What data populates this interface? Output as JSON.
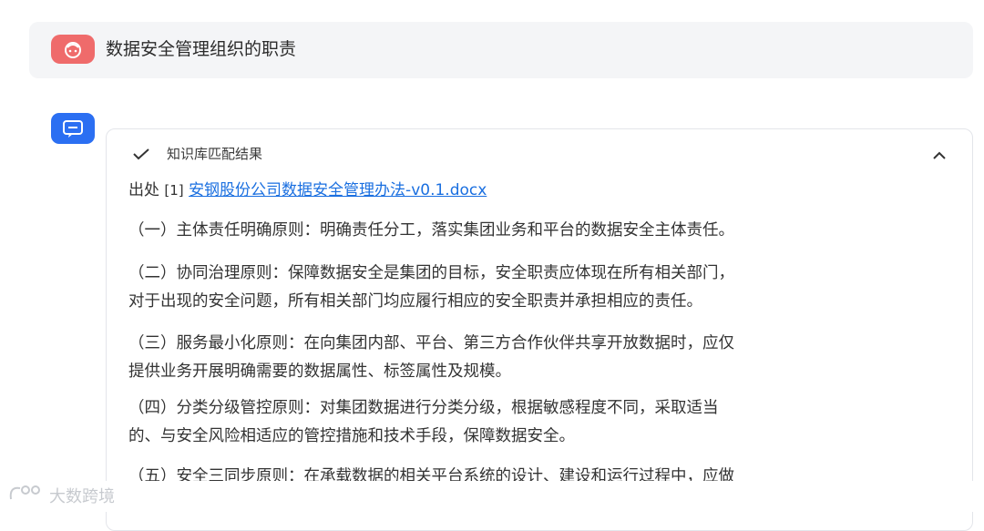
{
  "user": {
    "question": "数据安全管理组织的职责"
  },
  "answer": {
    "kb_header": "知识库匹配结果",
    "source_prefix": "出处",
    "source_index": "[1]",
    "source_link": "安钢股份公司数据安全管理办法-v0.1.docx",
    "principles": [
      {
        "lines": [
          "（一）主体责任明确原则：明确责任分工，落实集团业务和平台的数据安全主体责任。"
        ]
      },
      {
        "lines": [
          "（二）协同治理原则：保障数据安全是集团的目标，安全职责应体现在所有相关部门，",
          "对于出现的安全问题，所有相关部门均应履行相应的安全职责并承担相应的责任。"
        ]
      },
      {
        "lines": [
          "（三）服务最小化原则：在向集团内部、平台、第三方合作伙伴共享开放数据时，应仅",
          "提供业务开展明确需要的数据属性、标签属性及规模。"
        ]
      },
      {
        "lines": [
          "（四）分类分级管控原则：对集团数据进行分类分级，根据敏感程度不同，采取适当",
          "的、与安全风险相适应的管控措施和技术手段，保障数据安全。"
        ]
      },
      {
        "lines": [
          "（五）安全三同步原则：在承载数据的相关平台系统的设计、建设和运行过程中，应做"
        ]
      }
    ]
  },
  "icons": {
    "user_avatar": "user-avatar-icon",
    "bot_avatar": "bot-chat-icon",
    "check": "check-icon",
    "collapse": "chevron-up-icon"
  },
  "colors": {
    "user_avatar_bg": "#ef6b6b",
    "bot_avatar_bg": "#2b6ff2",
    "link": "#1a6fe0",
    "question_bar_bg": "#f4f5f7"
  },
  "watermark": {
    "text": "大数跨境"
  }
}
